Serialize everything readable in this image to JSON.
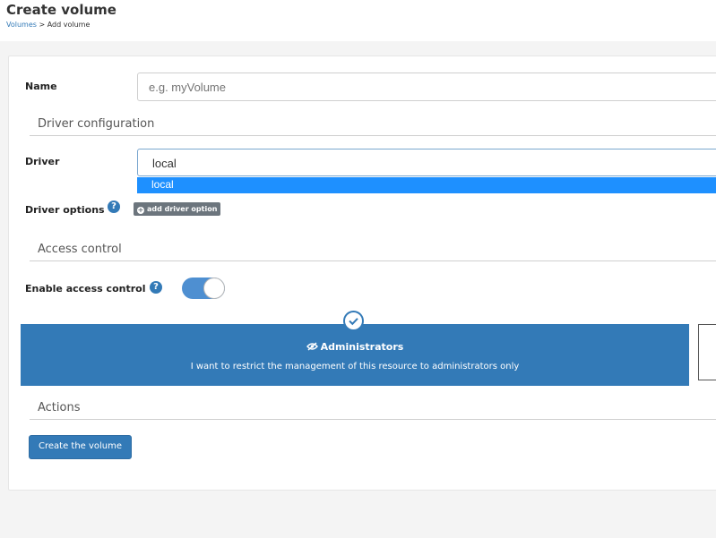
{
  "header": {
    "title": "Create volume",
    "breadcrumb": {
      "link": "Volumes",
      "separator": ">",
      "current": "Add volume"
    }
  },
  "form": {
    "name_label": "Name",
    "name_placeholder": "e.g. myVolume",
    "name_value": "",
    "driver_section_title": "Driver configuration",
    "driver_label": "Driver",
    "driver_selected": "local",
    "driver_options": [
      "local"
    ],
    "driver_options_label": "Driver options",
    "help_glyph": "?",
    "add_driver_option_label": "add driver option",
    "access_section_title": "Access control",
    "enable_access_control_label": "Enable access control",
    "enable_access_control_on": true,
    "administrators_title": "Administrators",
    "administrators_desc": "I want to restrict the management of this resource to administrators only",
    "actions_section_title": "Actions",
    "create_button_label": "Create the volume"
  },
  "colors": {
    "primary": "#337ab7",
    "dropdown_highlight": "#1e90ff",
    "secondary_button": "#6c757d",
    "toggle_on": "#4e8fd1"
  },
  "icons": {
    "help": "question-circle-icon",
    "add": "plus-circle-icon",
    "check": "check-circle-icon",
    "admin": "eye-slash-icon"
  }
}
